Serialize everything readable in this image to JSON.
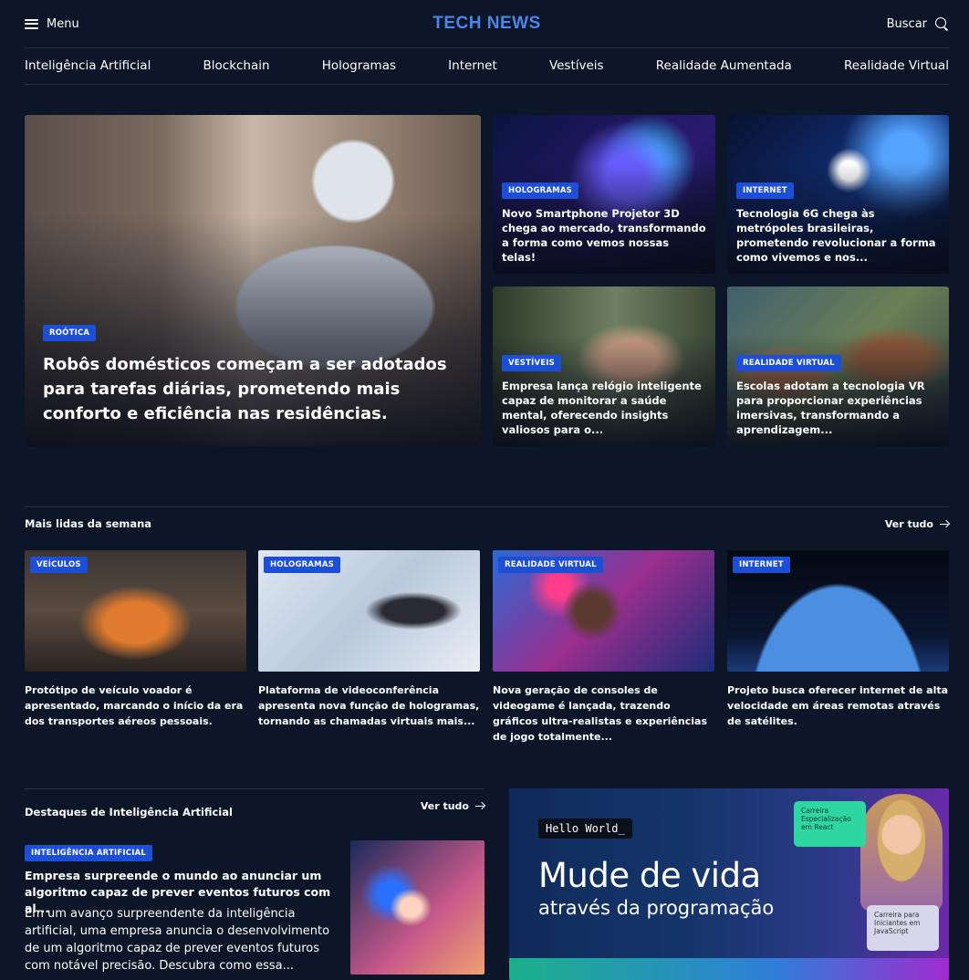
{
  "header": {
    "menu_label": "Menu",
    "logo": "TECH NEWS",
    "search_label": "Buscar"
  },
  "nav": [
    "Inteligência Artificial",
    "Blockchain",
    "Hologramas",
    "Internet",
    "Vestíveis",
    "Realidade Aumentada",
    "Realidade Virtual"
  ],
  "hero": {
    "main": {
      "tag": "ROÓTICA",
      "title": "Robôs domésticos começam a ser adotados para tarefas diárias, prometendo mais conforto e eficiência nas residências."
    },
    "side": [
      {
        "tag": "HOLOGRAMAS",
        "title": "Novo Smartphone Projetor 3D chega ao mercado, transformando a forma como vemos nossas telas!"
      },
      {
        "tag": "INTERNET",
        "title": "Tecnologia 6G chega às metrópoles brasileiras, prometendo revolucionar a forma como vivemos e nos..."
      },
      {
        "tag": "VESTÍVEIS",
        "title": "Empresa lança relógio inteligente capaz de monitorar a saúde mental, oferecendo insights valiosos para o..."
      },
      {
        "tag": "REALIDADE VIRTUAL",
        "title": "Escolas adotam a tecnologia VR para proporcionar experiências imersivas, transformando a aprendizagem..."
      }
    ]
  },
  "most_read": {
    "title": "Mais lidas da semana",
    "see_all": "Ver tudo",
    "items": [
      {
        "tag": "VEÍCULOS",
        "title": "Protótipo de veículo voador é apresentado, marcando o início da era dos transportes aéreos pessoais."
      },
      {
        "tag": "HOLOGRAMAS",
        "title": "Plataforma de videoconferência apresenta nova função de hologramas, tornando as chamadas virtuais mais..."
      },
      {
        "tag": "REALIDADE VIRTUAL",
        "title": "Nova geração de consoles de videogame é lançada, trazendo gráficos ultra-realistas e experiências de jogo totalmente..."
      },
      {
        "tag": "INTERNET",
        "title": "Projeto busca oferecer internet de alta velocidade em áreas remotas através de satélites."
      }
    ]
  },
  "ai_highlights": {
    "title": "Destaques de Inteligência Artificial",
    "see_all": "Ver tudo",
    "tag": "INTELIGÊNCIA ARTIFICIAL",
    "headline": "Empresa surpreende o mundo ao anunciar um algoritmo capaz de prever eventos futuros com al...",
    "description": "Em um avanço surpreendente da inteligência artificial, uma empresa anuncia o desenvolvimento de um algoritmo capaz de prever eventos futuros com notável precisão. Descubra como essa..."
  },
  "promo": {
    "code": "Hello World_",
    "headline": "Mude de vida",
    "subheadline": "através da programação",
    "chip_top": "Carreira Especialização em React",
    "chip_bottom": "Carreira para Iniciantes em JavaScript"
  }
}
